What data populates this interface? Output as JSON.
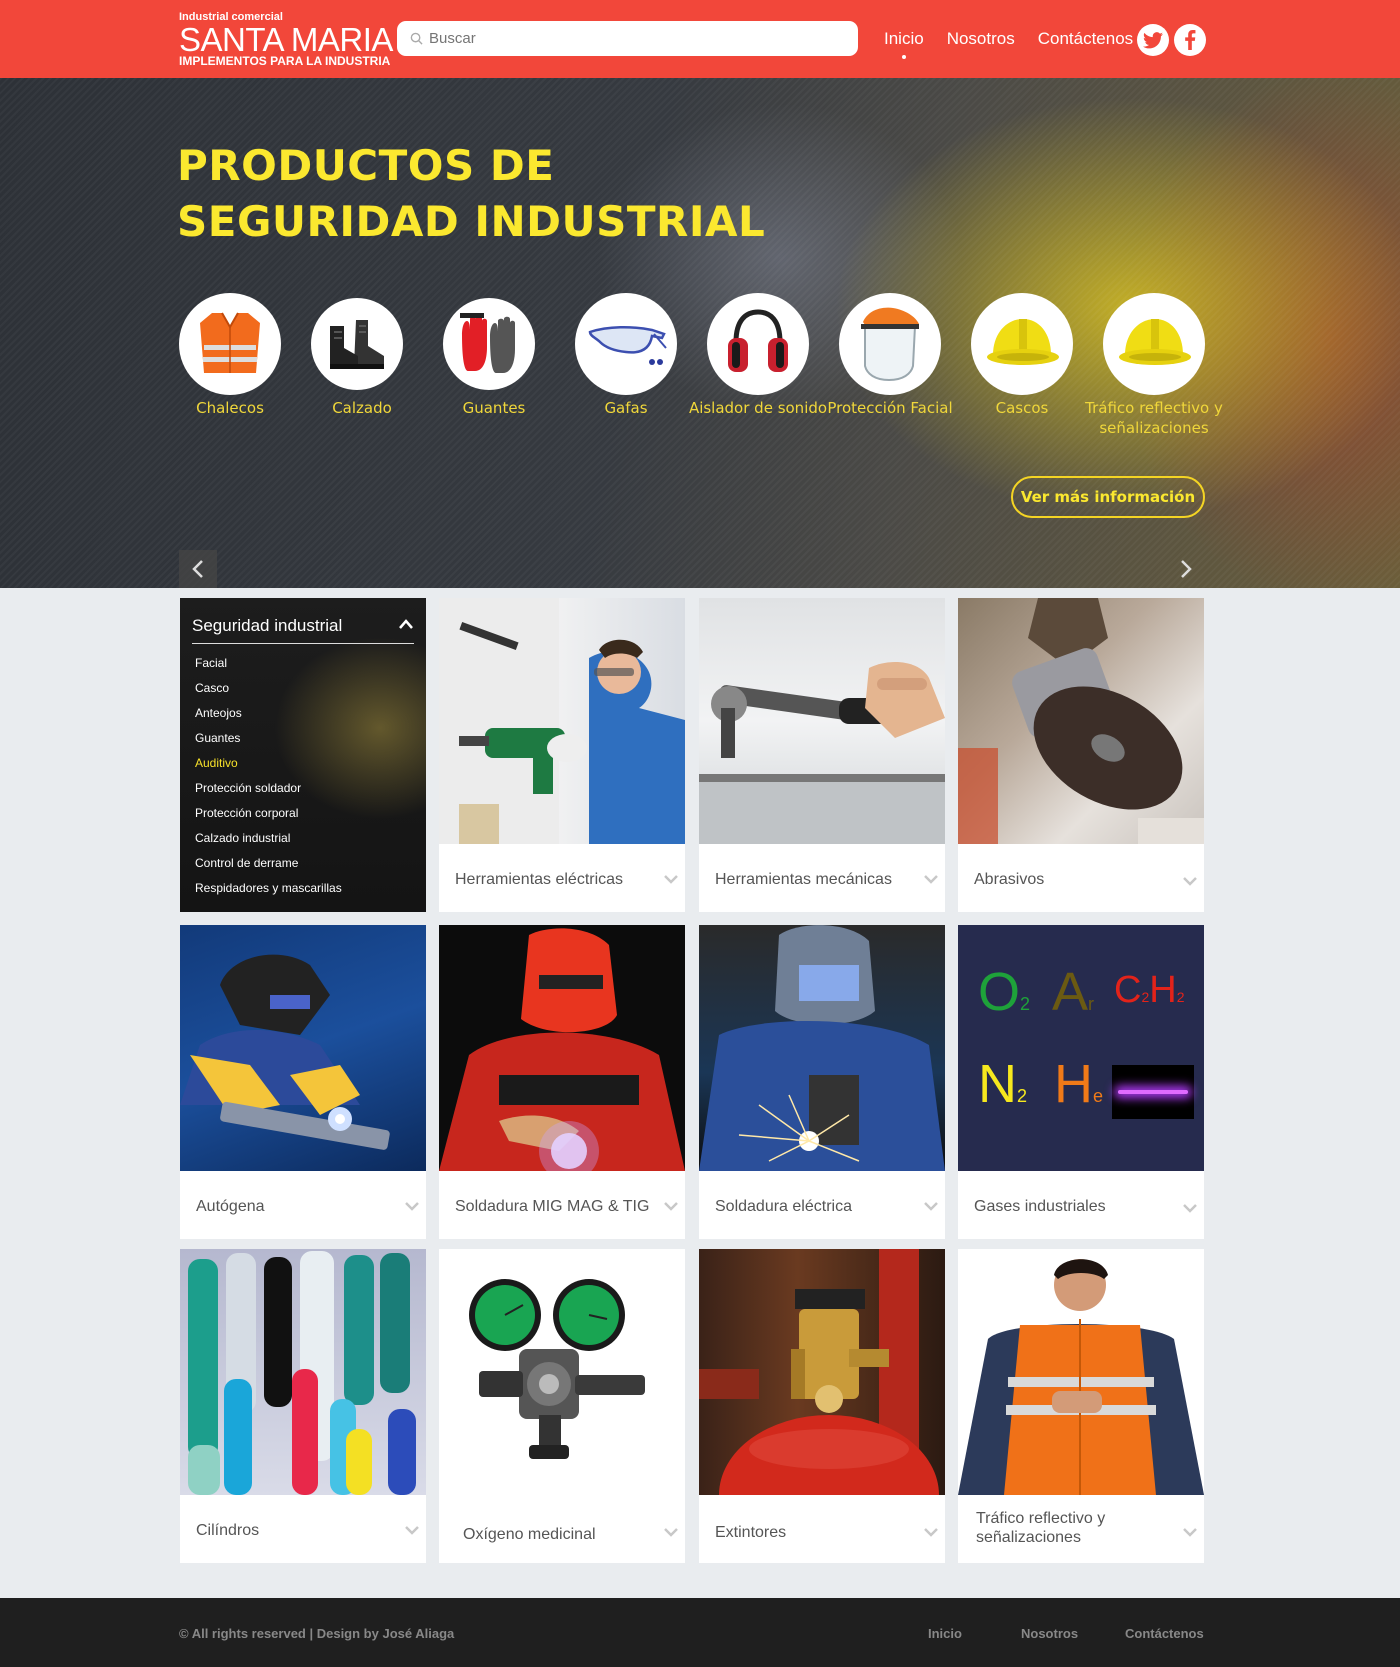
{
  "header": {
    "logo_top": "Industrial comercial",
    "logo_main": "SANTA MARIA",
    "logo_sub": "IMPLEMENTOS PARA LA INDUSTRIA",
    "search_placeholder": "Buscar",
    "nav": [
      "Inicio",
      "Nosotros",
      "Contáctenos"
    ],
    "social": [
      "twitter-icon",
      "facebook-icon"
    ],
    "accent": "#f2473a"
  },
  "hero": {
    "title_line1": "PRODUCTOS DE",
    "title_line2": "SEGURIDAD INDUSTRIAL",
    "categories": [
      {
        "label": "Chalecos",
        "icon": "vest-icon"
      },
      {
        "label": "Calzado",
        "icon": "boots-icon"
      },
      {
        "label": "Guantes",
        "icon": "gloves-icon"
      },
      {
        "label": "Gafas",
        "icon": "goggles-icon"
      },
      {
        "label": "Aislador de sonido",
        "icon": "earmuffs-icon"
      },
      {
        "label": "Protección Facial",
        "icon": "face-shield-icon"
      },
      {
        "label": "Cascos",
        "icon": "helmet-icon"
      },
      {
        "label": "Tráfico reflectivo y señalizaciones",
        "icon": "helmet-icon"
      }
    ],
    "more_button": "Ver más información",
    "title_color": "#fbe82f"
  },
  "sidebar": {
    "title": "Seguridad industrial",
    "items": [
      "Facial",
      "Casco",
      "Anteojos",
      "Guantes",
      "Auditivo",
      "Protección soldador",
      "Protección corporal",
      "Calzado industrial",
      "Control de derrame",
      "Respidadores y mascarillas"
    ],
    "highlighted": "Auditivo",
    "highlight_color": "#f8e22a"
  },
  "products": [
    "Herramientas eléctricas",
    "Herramientas mecánicas",
    "Abrasivos",
    "Autógena",
    "Soldadura MIG MAG & TIG",
    "Soldadura eléctrica",
    "Gases industriales",
    "Cilíndros",
    "Oxígeno medicinal",
    "Extintores",
    "Tráfico reflectivo y señalizaciones"
  ],
  "gases": {
    "o2": "O",
    "o2_sub": "2",
    "ar": "A",
    "ar_sub": "r",
    "c2h2_c": "C",
    "c2h2_c_sub": "2",
    "c2h2_h": "H",
    "c2h2_h_sub": "2",
    "n2": "N",
    "n2_sub": "2",
    "he": "H",
    "he_sub": "e"
  },
  "footer": {
    "copyright": "© All rights reserved | Design by  José Aliaga",
    "nav": [
      "Inicio",
      "Nosotros",
      "Contáctenos"
    ]
  }
}
